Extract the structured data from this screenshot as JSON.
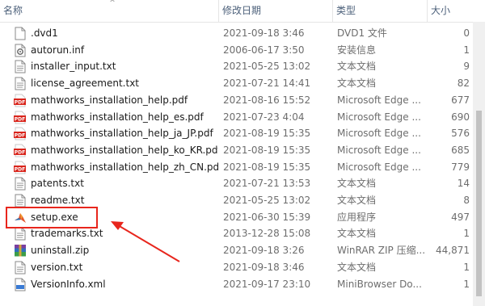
{
  "columns": {
    "name": "名称",
    "date": "修改日期",
    "type": "类型",
    "size": "大小"
  },
  "files": [
    {
      "name": ".dvd1",
      "date": "2021-09-18 3:46",
      "type": "DVD1 文件",
      "size": "0",
      "icon": "generic-file-icon"
    },
    {
      "name": "autorun.inf",
      "date": "2006-06-17 3:50",
      "type": "安装信息",
      "size": "1",
      "icon": "setup-info-icon"
    },
    {
      "name": "installer_input.txt",
      "date": "2021-05-25 13:02",
      "type": "文本文档",
      "size": "9",
      "icon": "text-file-icon"
    },
    {
      "name": "license_agreement.txt",
      "date": "2021-07-21 14:41",
      "type": "文本文档",
      "size": "82",
      "icon": "text-file-icon"
    },
    {
      "name": "mathworks_installation_help.pdf",
      "date": "2021-08-16 15:52",
      "type": "Microsoft Edge ...",
      "size": "677",
      "icon": "pdf-file-icon"
    },
    {
      "name": "mathworks_installation_help_es.pdf",
      "date": "2021-07-23 4:04",
      "type": "Microsoft Edge ...",
      "size": "690",
      "icon": "pdf-file-icon"
    },
    {
      "name": "mathworks_installation_help_ja_JP.pdf",
      "date": "2021-08-19 15:35",
      "type": "Microsoft Edge ...",
      "size": "576",
      "icon": "pdf-file-icon"
    },
    {
      "name": "mathworks_installation_help_ko_KR.pdf",
      "date": "2021-08-19 15:35",
      "type": "Microsoft Edge ...",
      "size": "685",
      "icon": "pdf-file-icon"
    },
    {
      "name": "mathworks_installation_help_zh_CN.pdf",
      "date": "2021-08-19 15:35",
      "type": "Microsoft Edge ...",
      "size": "779",
      "icon": "pdf-file-icon"
    },
    {
      "name": "patents.txt",
      "date": "2021-07-21 13:53",
      "type": "文本文档",
      "size": "14",
      "icon": "text-file-icon"
    },
    {
      "name": "readme.txt",
      "date": "2021-05-25 13:02",
      "type": "文本文档",
      "size": "8",
      "icon": "text-file-icon"
    },
    {
      "name": "setup.exe",
      "date": "2021-06-30 15:39",
      "type": "应用程序",
      "size": "497",
      "icon": "matlab-app-icon"
    },
    {
      "name": "trademarks.txt",
      "date": "2013-12-28 15:08",
      "type": "文本文档",
      "size": "1",
      "icon": "text-file-icon"
    },
    {
      "name": "uninstall.zip",
      "date": "2021-09-18 3:26",
      "type": "WinRAR ZIP 压缩...",
      "size": "44,871",
      "icon": "winrar-zip-icon"
    },
    {
      "name": "version.txt",
      "date": "2021-09-18 3:46",
      "type": "文本文档",
      "size": "1",
      "icon": "text-file-icon"
    },
    {
      "name": "VersionInfo.xml",
      "date": "2021-09-17 23:10",
      "type": "MiniBrowser Do...",
      "size": "1",
      "icon": "xml-file-icon"
    }
  ],
  "colors": {
    "annotation": "#e8261d",
    "pdf": "#d9251c",
    "header_text": "#4c607a"
  }
}
